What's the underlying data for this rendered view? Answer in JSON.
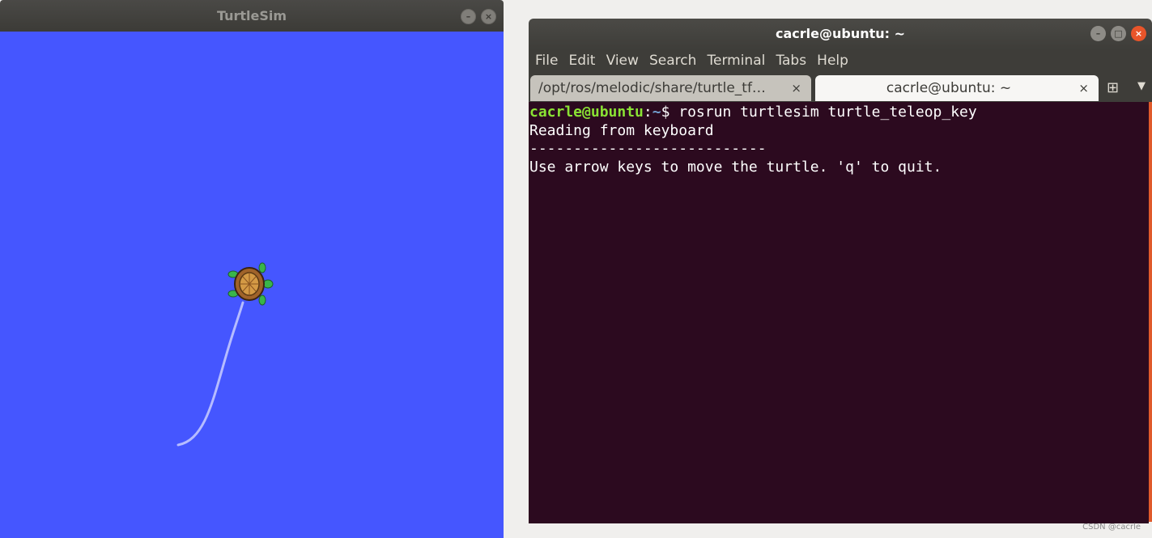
{
  "turtlesim": {
    "title": "TurtleSim",
    "canvas_color": "#4556ff",
    "path_color": "#b6bcff"
  },
  "terminal": {
    "title": "cacrle@ubuntu: ~",
    "menu": [
      "File",
      "Edit",
      "View",
      "Search",
      "Terminal",
      "Tabs",
      "Help"
    ],
    "tabs": [
      {
        "label": "/opt/ros/melodic/share/turtle_tf…",
        "close": "×"
      },
      {
        "label": "cacrle@ubuntu: ~",
        "close": "×"
      }
    ],
    "prompt_user": "cacrle@ubuntu",
    "prompt_sep": ":",
    "prompt_path": "~",
    "prompt_symbol": "$",
    "command": " rosrun turtlesim turtle_teleop_key",
    "output": [
      "Reading from keyboard",
      "---------------------------",
      "Use arrow keys to move the turtle. 'q' to quit."
    ],
    "colors": {
      "background": "#2c0a1f",
      "prompt_user": "#8ae234",
      "prompt_path": "#729fcf",
      "close_button": "#e9552a"
    }
  },
  "watermark": "CSDN @cacrle"
}
